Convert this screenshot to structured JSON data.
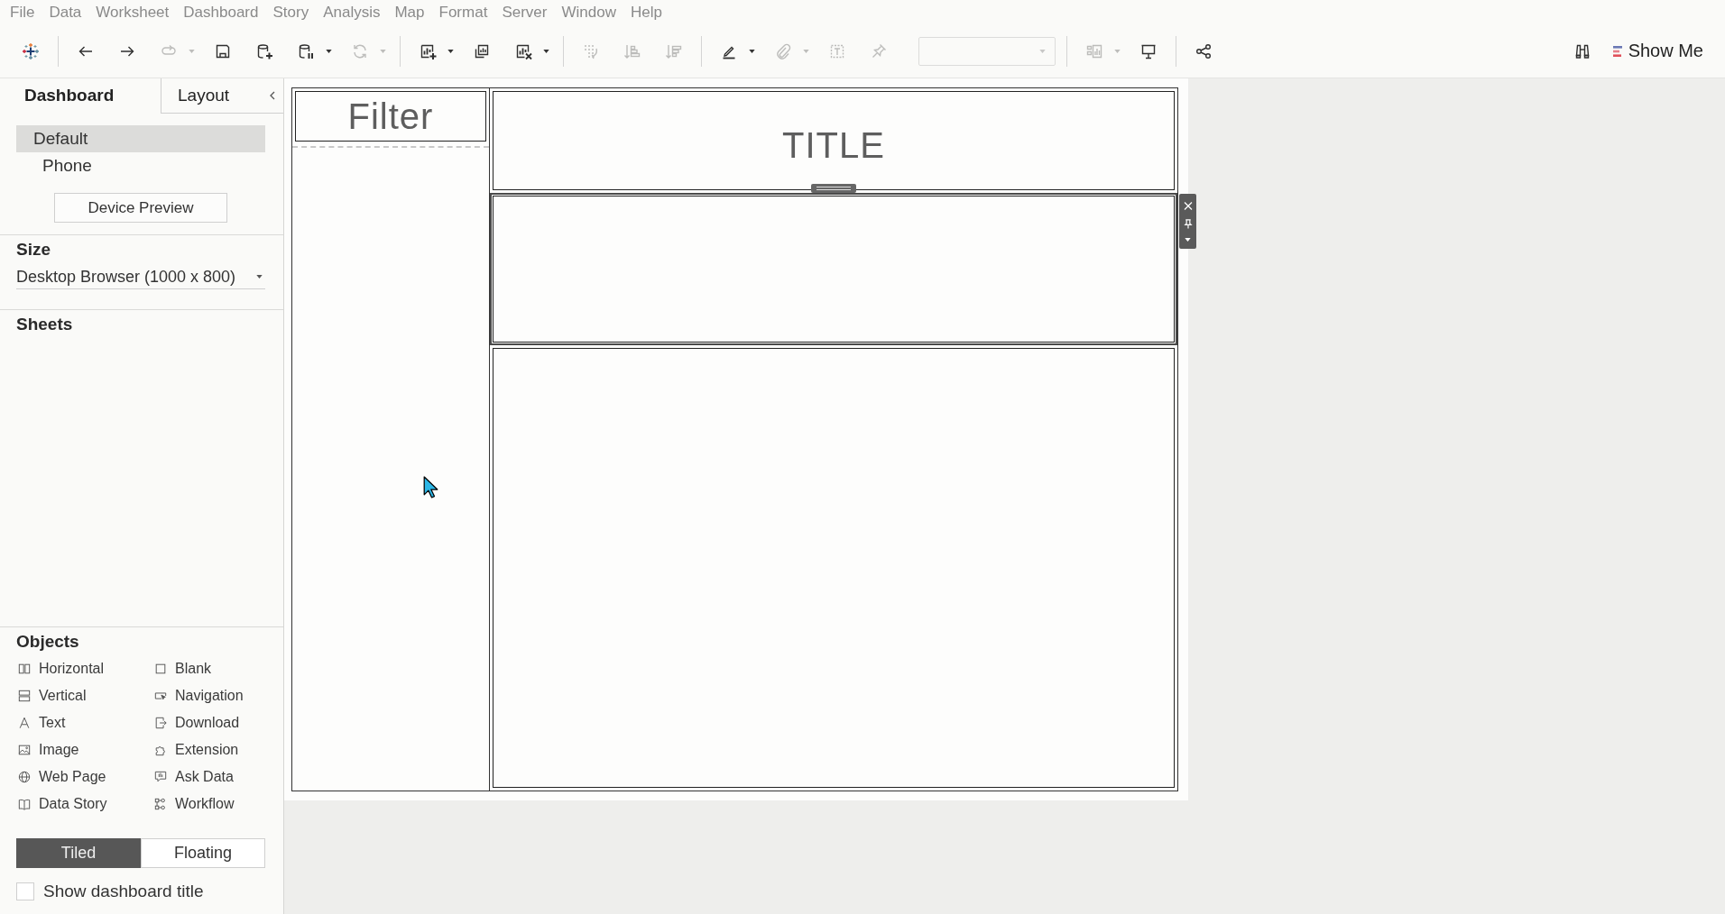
{
  "menu_bar": {
    "items": [
      "File",
      "Data",
      "Worksheet",
      "Dashboard",
      "Story",
      "Analysis",
      "Map",
      "Format",
      "Server",
      "Window",
      "Help"
    ]
  },
  "toolbar": {
    "groups": [
      [
        {
          "kind": "button",
          "disabled": false,
          "menu": false
        }
      ],
      [
        {
          "kind": "button",
          "disabled": false,
          "menu": false
        },
        {
          "kind": "button",
          "disabled": false,
          "menu": false
        },
        {
          "kind": "button",
          "disabled": true,
          "menu": true
        },
        {
          "kind": "button",
          "disabled": false,
          "menu": false
        },
        {
          "kind": "button",
          "disabled": false,
          "menu": false
        },
        {
          "kind": "button",
          "disabled": false,
          "menu": true
        },
        {
          "kind": "button",
          "disabled": true,
          "menu": true
        }
      ],
      [
        {
          "kind": "button",
          "disabled": false,
          "menu": true
        },
        {
          "kind": "button",
          "disabled": false,
          "menu": false
        },
        {
          "kind": "button",
          "disabled": false,
          "menu": true
        }
      ],
      [
        {
          "kind": "button",
          "disabled": true,
          "menu": false
        },
        {
          "kind": "button",
          "disabled": true,
          "menu": false
        },
        {
          "kind": "button",
          "disabled": true,
          "menu": false
        }
      ],
      [
        {
          "kind": "button",
          "disabled": false,
          "menu": true
        },
        {
          "kind": "button",
          "disabled": true,
          "menu": true
        },
        {
          "kind": "button",
          "disabled": true,
          "menu": false
        },
        {
          "kind": "button",
          "disabled": true,
          "menu": false
        },
        {
          "kind": "select",
          "disabled": true
        }
      ],
      [
        {
          "kind": "button",
          "disabled": true,
          "menu": true
        },
        {
          "kind": "button",
          "disabled": false,
          "menu": false
        }
      ],
      [
        {
          "kind": "button",
          "disabled": false,
          "menu": false
        }
      ]
    ],
    "right": [
      {
        "kind": "button",
        "disabled": false,
        "menu": false
      }
    ],
    "show_me": {
      "label": "Show Me"
    }
  },
  "side_panel": {
    "tabs": [
      {
        "label": "Dashboard",
        "selected": true
      },
      {
        "label": "Layout",
        "selected": false
      }
    ],
    "devices": [
      {
        "label": "Default",
        "selected": true
      },
      {
        "label": "Phone",
        "selected": false
      }
    ],
    "device_preview": {
      "label": "Device Preview"
    },
    "size": {
      "heading": "Size",
      "value": "Desktop Browser (1000 x 800)"
    },
    "sheets": {
      "heading": "Sheets"
    },
    "objects": {
      "heading": "Objects",
      "items": [
        {
          "label": "Horizontal"
        },
        {
          "label": "Blank"
        },
        {
          "label": "Vertical"
        },
        {
          "label": "Navigation"
        },
        {
          "label": "Text"
        },
        {
          "label": "Download"
        },
        {
          "label": "Image"
        },
        {
          "label": "Extension"
        },
        {
          "label": "Web Page"
        },
        {
          "label": "Ask Data"
        },
        {
          "label": "Data Story"
        },
        {
          "label": "Workflow"
        }
      ]
    },
    "layout_modes": [
      {
        "label": "Tiled",
        "selected": true
      },
      {
        "label": "Floating",
        "selected": false
      }
    ],
    "show_title": {
      "label": "Show dashboard title",
      "checked": false
    }
  },
  "dashboard": {
    "left_container": {
      "filter": {
        "text": "Filter"
      }
    },
    "zones": [
      {
        "kind": "text",
        "text": "TITLE",
        "selected": false
      },
      {
        "kind": "blank",
        "selected": true
      },
      {
        "kind": "blank",
        "selected": false
      }
    ]
  }
}
